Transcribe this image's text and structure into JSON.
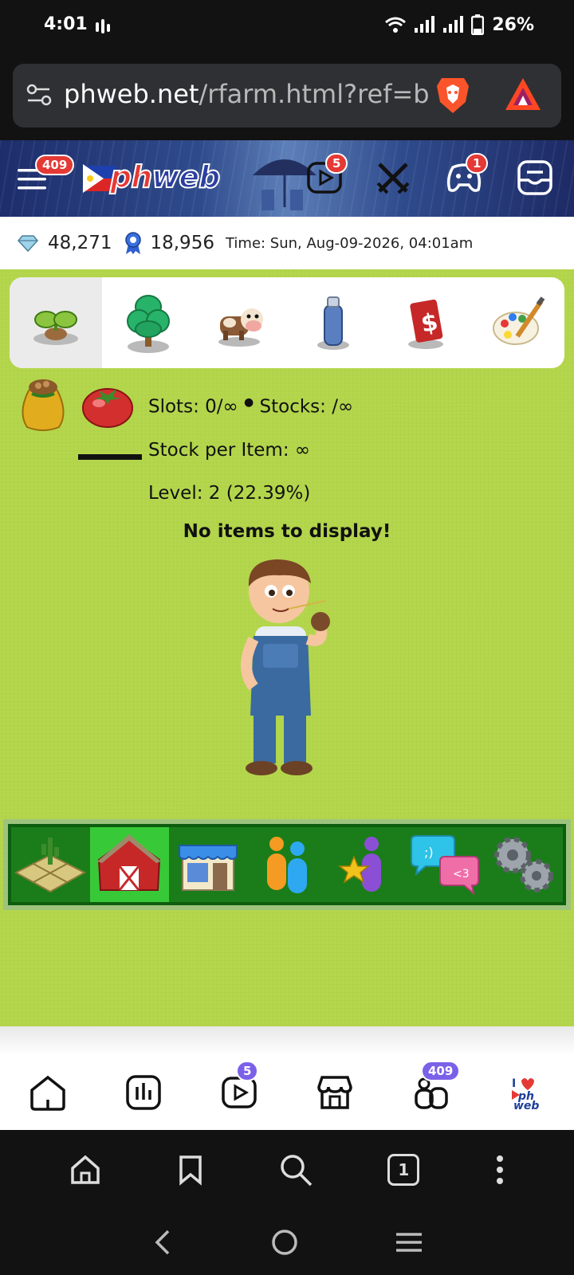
{
  "status_bar": {
    "time": "4:01",
    "battery": "26%"
  },
  "browser": {
    "url_host": "phweb.net",
    "url_path": "/rfarm.html?ref=barn",
    "tab_count": "1"
  },
  "site_header": {
    "menu_badge": "409",
    "logo_text_a": "ph",
    "logo_text_b": "web",
    "reels_badge": "5",
    "games_badge": "1"
  },
  "currency": {
    "gems": "48,271",
    "ribbons": "18,956",
    "time_label": "Time: Sun, Aug-09-2026, 04:01am"
  },
  "category_tabs": [
    {
      "name": "seeds",
      "active": true
    },
    {
      "name": "trees",
      "active": false
    },
    {
      "name": "animals",
      "active": false
    },
    {
      "name": "decor",
      "active": false
    },
    {
      "name": "money",
      "active": false
    },
    {
      "name": "paint",
      "active": false
    }
  ],
  "barn": {
    "slots": "Slots: 0/∞",
    "stocks": "Stocks: /∞",
    "stock_per_item": "Stock per Item: ∞",
    "level": "Level: 2 (22.39%)",
    "empty_message": "No items to display!"
  },
  "bottom_menu": [
    {
      "name": "farm",
      "active": false
    },
    {
      "name": "barn",
      "active": true
    },
    {
      "name": "shop",
      "active": false
    },
    {
      "name": "neighbors",
      "active": false
    },
    {
      "name": "achievements",
      "active": false
    },
    {
      "name": "chat",
      "active": false
    },
    {
      "name": "settings",
      "active": false
    }
  ],
  "site_nav": {
    "reels_badge": "5",
    "groups_badge": "409",
    "profile_label": "I ph web"
  },
  "colors": {
    "grass": "#b4d64c",
    "menu_green": "#1a7d1a",
    "badge_red": "#e53935",
    "badge_purple": "#7b61e8"
  }
}
